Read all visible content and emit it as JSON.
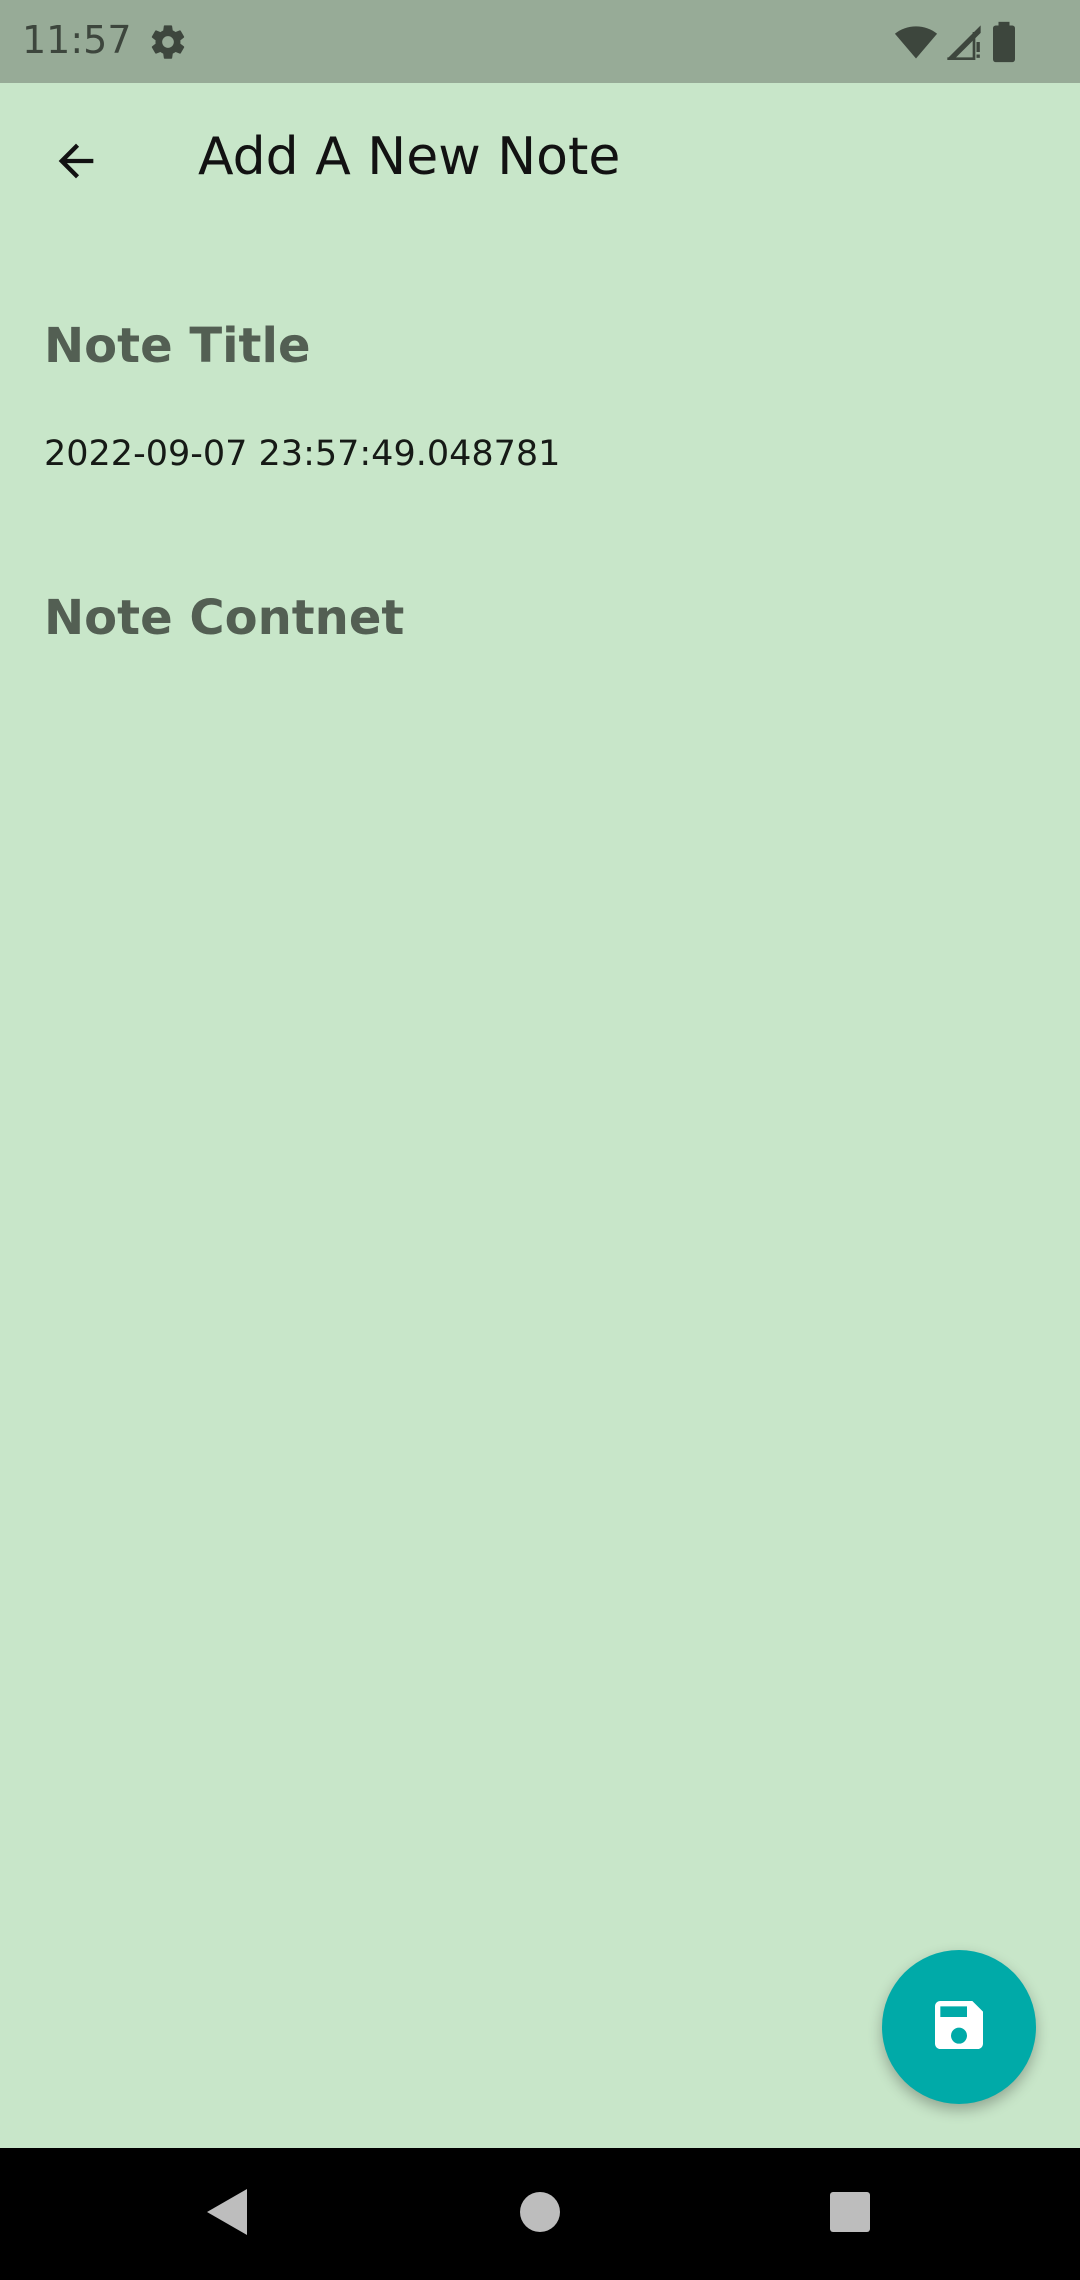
{
  "status_bar": {
    "time": "11:57",
    "icons": [
      "gear-icon",
      "wifi-icon",
      "signal-icon",
      "battery-icon"
    ]
  },
  "app_bar": {
    "title": "Add A New Note",
    "back_icon": "arrow-left-icon"
  },
  "form": {
    "title_label": "Note Title",
    "title_value": "2022-09-07 23:57:49.048781",
    "content_label": "Note Contnet",
    "content_value": ""
  },
  "fab": {
    "icon": "save-icon",
    "color": "#00aaa8"
  },
  "nav_bar": {
    "buttons": [
      "back-icon",
      "home-icon",
      "recents-icon"
    ]
  },
  "colors": {
    "background": "#c8e6c9",
    "status_bar": "#97ab97",
    "label": "#535f53",
    "accent": "#00aaa8"
  }
}
